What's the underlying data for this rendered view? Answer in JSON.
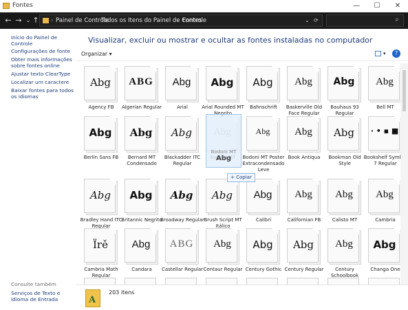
{
  "window": {
    "title": "Fontes",
    "min": "—",
    "max": "☐",
    "close": "✕"
  },
  "nav": {
    "back": "←",
    "forward": "→",
    "recent": "⌄",
    "up": "↑"
  },
  "address": {
    "crumbs": [
      "Painel de Controle",
      "Todos os Itens do Painel de Controle",
      "Fontes"
    ],
    "sep": "›",
    "dropdown": "⌄",
    "refresh": "⟳"
  },
  "search": {
    "placeholder": "",
    "icon": "⌕"
  },
  "sidebar": {
    "home": "Início do Painel de Controle",
    "links": [
      "Configurações de fonte",
      "Obter mais informações sobre fontes online",
      "Ajustar texto ClearType",
      "Localizar um caractere",
      "Baixar fontes para todos os idiomas"
    ],
    "see_also_title": "Consulte também",
    "see_also": [
      "Serviços de Texto e Idioma de Entrada"
    ]
  },
  "main": {
    "heading": "Visualizar, excluir ou mostrar e ocultar as fontes instaladas no computador",
    "organize": "Organizar ▾",
    "view_arrow": "▾",
    "help": "?"
  },
  "fonts": [
    {
      "name": "Agency FB",
      "sample": "Abg"
    },
    {
      "name": "Algerian Regular",
      "sample": "ABG"
    },
    {
      "name": "Arial",
      "sample": "Abg"
    },
    {
      "name": "Arial Rounded MT Negrito",
      "sample": "Abg"
    },
    {
      "name": "Bahnschrift",
      "sample": "Abg"
    },
    {
      "name": "Baskerville Old Face Regular",
      "sample": "Abg"
    },
    {
      "name": "Bauhaus 93 Regular",
      "sample": "Abg"
    },
    {
      "name": "Bell MT",
      "sample": "Abg"
    },
    {
      "name": "Berlin Sans FB",
      "sample": "Abg"
    },
    {
      "name": "Bernard MT Condensado",
      "sample": "Abg"
    },
    {
      "name": "Blackadder ITC Regular",
      "sample": "Abg"
    },
    {
      "name": "Bodoni MT",
      "sample": "Abg"
    },
    {
      "name": "Bodoni MT Poster Extracondensado Leve",
      "sample": "Abg"
    },
    {
      "name": "Book Antiqua",
      "sample": "Abg"
    },
    {
      "name": "Bookman Old Style",
      "sample": "Abg"
    },
    {
      "name": "Bookshelf Symbol 7 Regular",
      "sample": "· • ▪ ■"
    },
    {
      "name": "Bradley Hand ITC Regular",
      "sample": "Abg"
    },
    {
      "name": "Britannic Negrito",
      "sample": "Abg"
    },
    {
      "name": "Broadway Regular",
      "sample": "Abg"
    },
    {
      "name": "Brush Script MT Itálico",
      "sample": "Abg"
    },
    {
      "name": "Calibri",
      "sample": "Abg"
    },
    {
      "name": "Californian FB",
      "sample": "Abg"
    },
    {
      "name": "Calisto MT",
      "sample": "Abg"
    },
    {
      "name": "Cambria",
      "sample": "Abg"
    },
    {
      "name": "Cambria Math Regular",
      "sample": "Ïrě"
    },
    {
      "name": "Candara",
      "sample": "Abg"
    },
    {
      "name": "Castellar Regular",
      "sample": "ABG"
    },
    {
      "name": "Centaur Regular",
      "sample": "Abg"
    },
    {
      "name": "Century Gothic",
      "sample": "Abg"
    },
    {
      "name": "Century Regular",
      "sample": "Abg"
    },
    {
      "name": "Century Schoolbook",
      "sample": "Abg"
    },
    {
      "name": "Changa One",
      "sample": "Abg"
    }
  ],
  "drag": {
    "name": "Bodoni MT",
    "sample": "Abg",
    "tooltip": "+ Copiar"
  },
  "status": {
    "count": "203 itens",
    "icon_letter": "A"
  }
}
